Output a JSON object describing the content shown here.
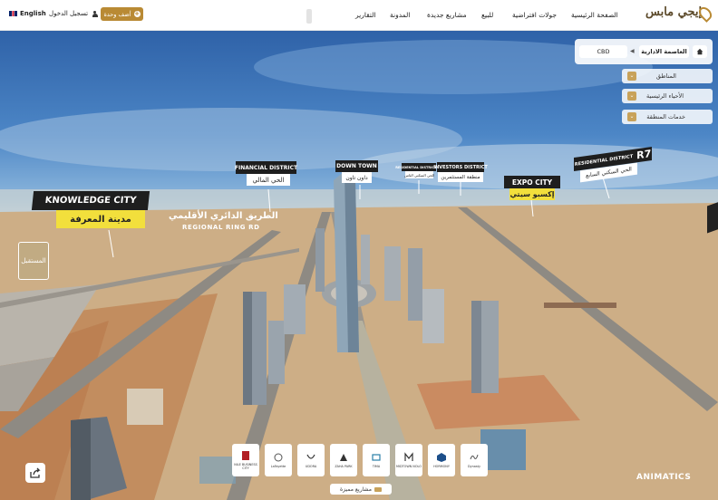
{
  "header": {
    "language_label": "English",
    "login_label": "تسجيل الدخول",
    "add_unit_label": "أضف وحدة",
    "nav": {
      "reports": "التقارير",
      "blog": "المدونة",
      "new_projects": "مشاريع جديدة",
      "for_sale": "للبيع",
      "virtual_tours": "جولات افتراضية",
      "home": "الصفحة الرئيسية"
    },
    "logo_text": "إيجي مابس"
  },
  "location_panel": {
    "breadcrumb": [
      "العاصمة الادارية",
      "CBD"
    ],
    "accordions": [
      "المناطق",
      "الأحياء الرئيسية",
      "خدمات المنطقة"
    ]
  },
  "map_labels": {
    "knowledge_city": {
      "en": "KNOWLEDGE CITY",
      "ar": "مدينة المعرفة"
    },
    "financial_district": {
      "en": "FINANCIAL DISTRICT",
      "ar": "الحي المالي"
    },
    "down_town": {
      "en": "DOWN TOWN",
      "ar": "داون تاون"
    },
    "r8": {
      "en": "RESIDENTIAL DISTRICT R8",
      "ar": "الحي السكني الثامن"
    },
    "investors_district": {
      "en": "INVESTORS DISTRICT",
      "ar": "منطقة المستثمرين"
    },
    "expo_city": {
      "en": "EXPO CITY",
      "ar": "إكسبو سيتي"
    },
    "r7": {
      "en": "RESIDENTIAL DISTRICT",
      "badge": "R7",
      "ar": "الحي السكني السابع"
    },
    "regional_ring_road": {
      "en": "REGIONAL RING RD",
      "ar": "الطريق الدائري الأقليمي"
    }
  },
  "future_button_label": "المستقبل",
  "developers": [
    "NILE BUSINESS CITY",
    "LaFayette",
    "UDORA",
    "ZAHA PARK",
    "TIMA",
    "MIDTOWN NOLO",
    "HORMONY",
    "Dynasty"
  ],
  "featured_projects_label": "مشاريع مميزة",
  "brand_watermark": "ANIMATICS",
  "colors": {
    "gold": "#b98a34",
    "label_yellow": "#f2df3c",
    "label_dark": "#1e1e1e"
  }
}
